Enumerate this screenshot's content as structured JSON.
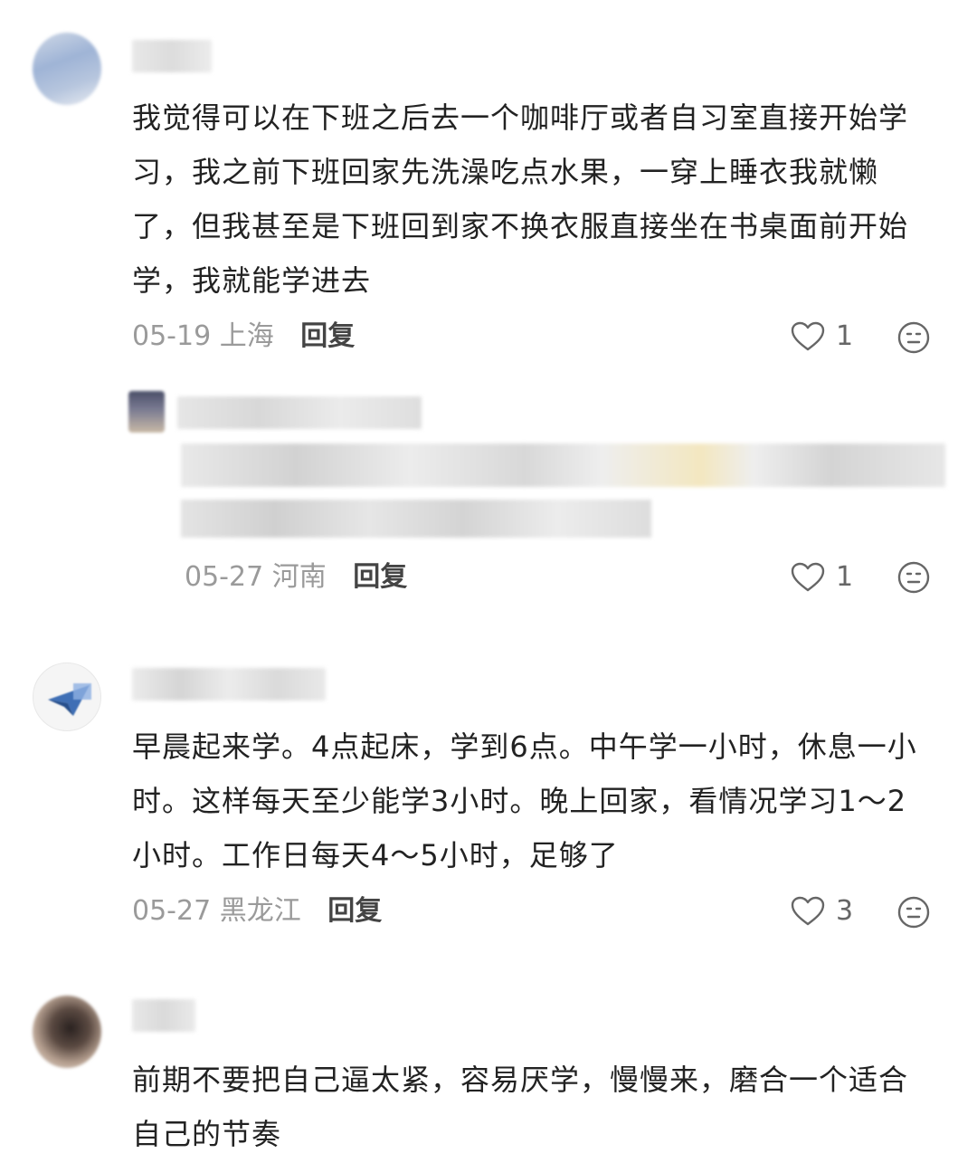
{
  "comments": [
    {
      "text_lines": [
        "我觉得可以在下班之后去一个咖啡厅或者自习室直接开始学",
        "习，我之前下班回家先洗澡吃点水果，一穿上睡衣我就懒",
        "了，但我甚至是下班回到家不换衣服直接坐在书桌面前开始",
        "学，我就能学进去"
      ],
      "date": "05-19",
      "location": "上海",
      "reply_label": "回复",
      "likes": "1"
    },
    {
      "date": "05-27",
      "location": "河南",
      "reply_label": "回复",
      "likes": "1"
    },
    {
      "text_lines": [
        "早晨起来学。4点起床，学到6点。中午学一小时，休息一小",
        "时。这样每天至少能学3小时。晚上回家，看情况学习1～2",
        "小时。工作日每天4～5小时，足够了"
      ],
      "date": "05-27",
      "location": "黑龙江",
      "reply_label": "回复",
      "likes": "3"
    },
    {
      "text_lines": [
        "前期不要把自己逼太紧，容易厌学，慢慢来，磨合一个适合",
        "自己的节奏"
      ]
    }
  ],
  "icons": {
    "like": "heart-outline-icon",
    "dislike": "meh-face-icon"
  },
  "colors": {
    "text": "#222222",
    "meta": "#9a9a9a",
    "reply": "#444444"
  }
}
